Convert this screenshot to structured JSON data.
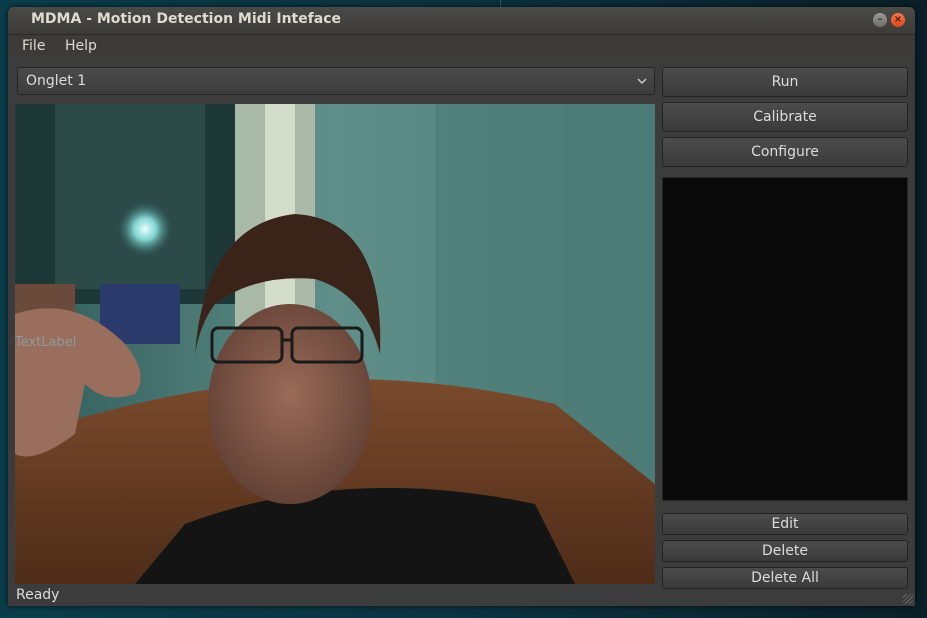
{
  "window": {
    "title": "MDMA - Motion Detection Midi Inteface",
    "minimize_glyph": "–",
    "close_glyph": "×"
  },
  "menu": {
    "items": [
      "File",
      "Help"
    ]
  },
  "tab_selector": {
    "selected": "Onglet 1",
    "arrow_icon": "chevron-down-icon"
  },
  "buttons": {
    "run": "Run",
    "calibrate": "Calibrate",
    "configure": "Configure",
    "edit": "Edit",
    "delete": "Delete",
    "delete_all": "Delete All"
  },
  "camera": {
    "overlay_label": "TextLabel"
  },
  "status_bar": {
    "text": "Ready"
  },
  "colors": {
    "window_bg": "#3c3c3c",
    "list_bg": "#0a0a0a",
    "close_button": "#e4572a"
  }
}
